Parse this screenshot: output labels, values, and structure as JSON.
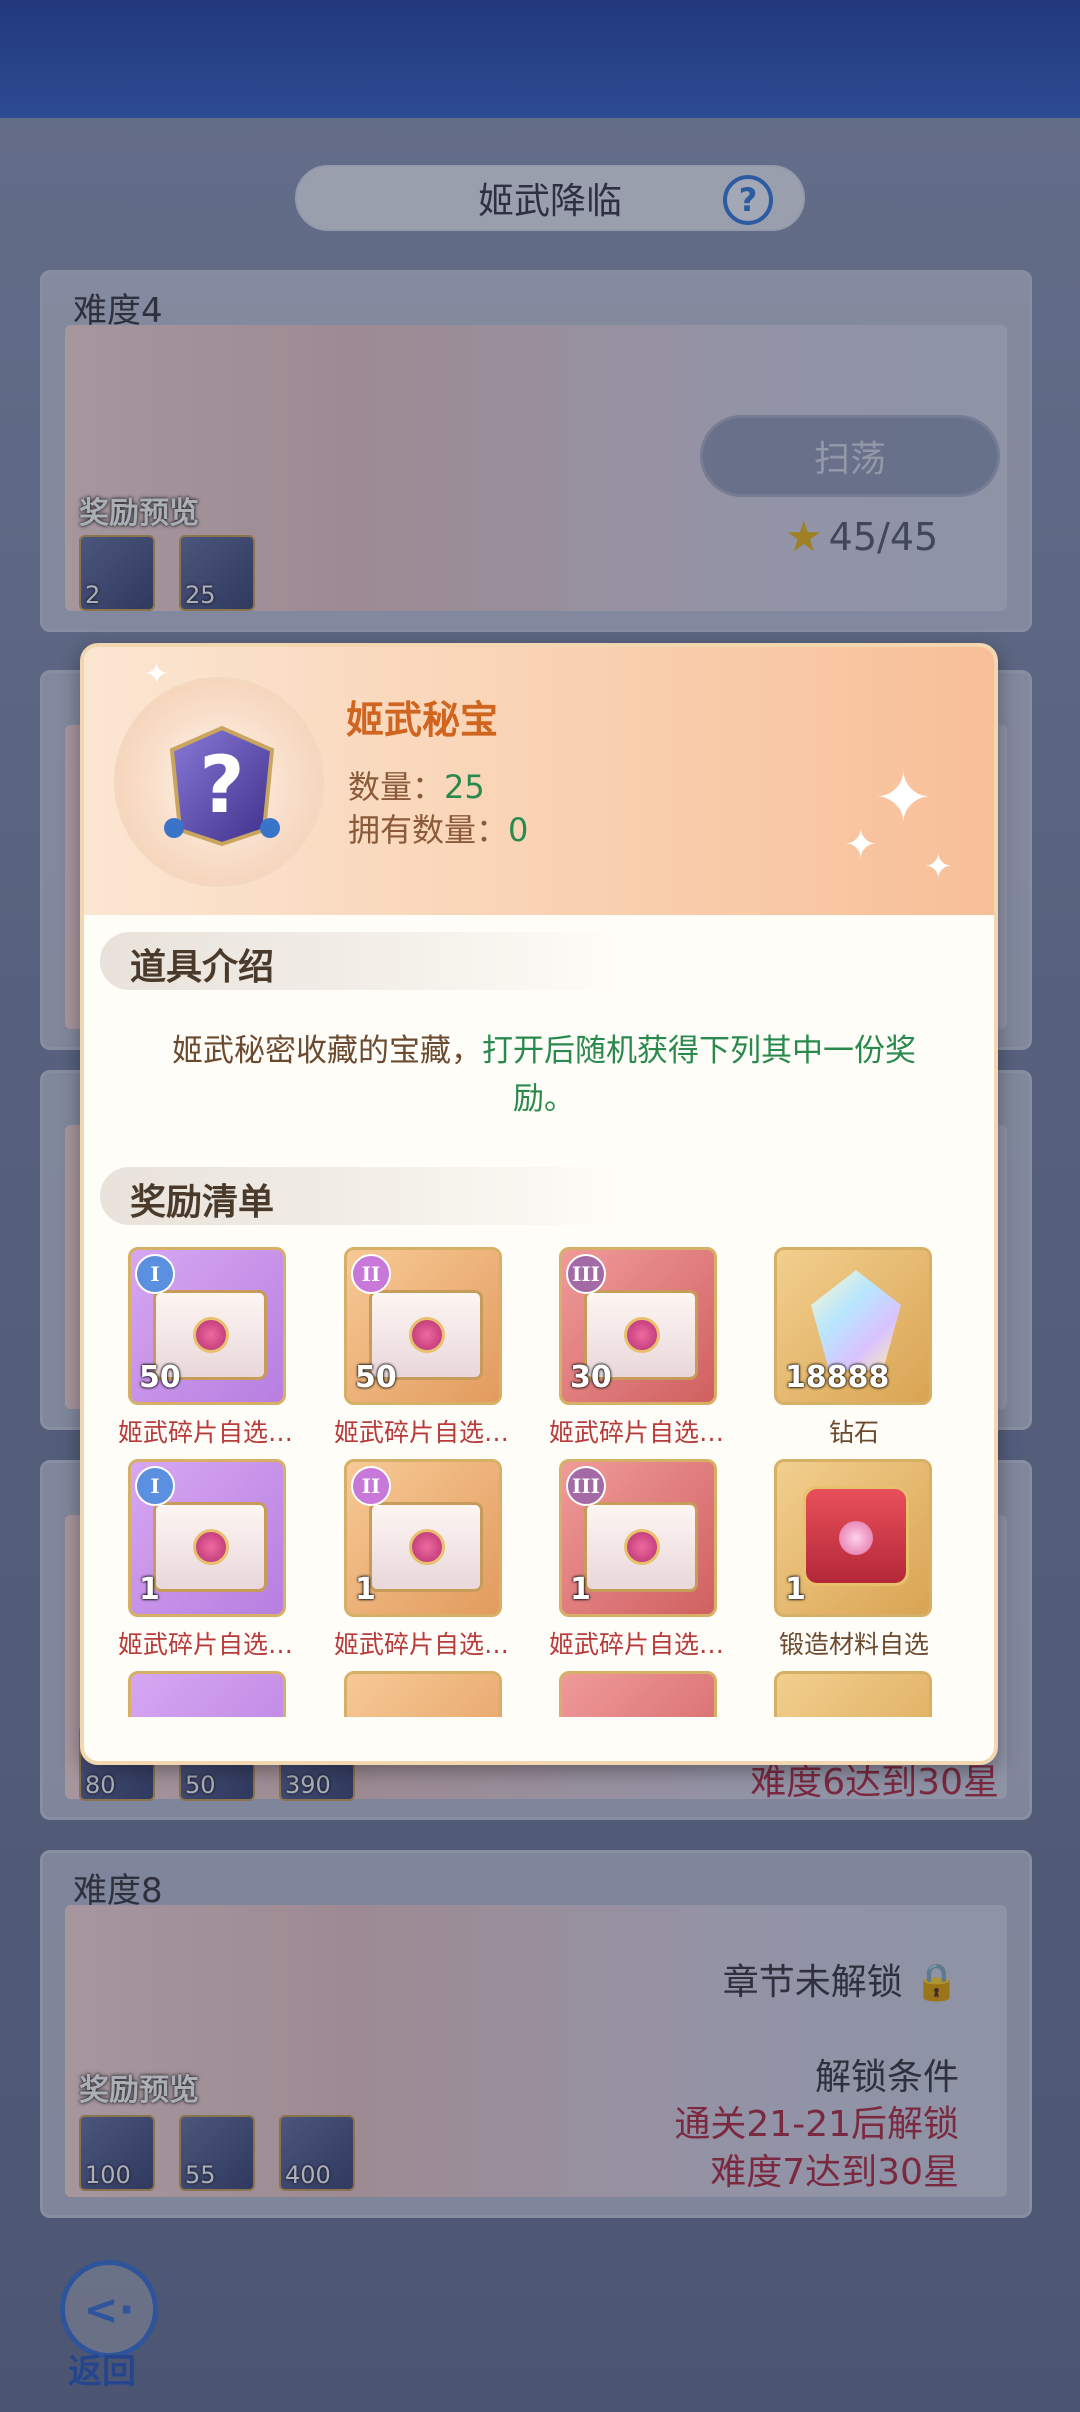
{
  "header": {
    "title": "姬武降临"
  },
  "stages": {
    "stage4": {
      "difficulty": "难度4",
      "preview_label": "奖励预览",
      "rewards": [
        "2",
        "25"
      ],
      "sweep_label": "扫荡",
      "stars": "45/45"
    },
    "stage7_partial": {
      "rewards": [
        "80",
        "50",
        "390"
      ],
      "unlock_line3": "难度6达到30星"
    },
    "stage8": {
      "difficulty": "难度8",
      "locked": "章节未解锁",
      "preview_label": "奖励预览",
      "rewards": [
        "100",
        "55",
        "400"
      ],
      "unlock_title": "解锁条件",
      "unlock_line1": "通关21-21后解锁",
      "unlock_line2": "难度7达到30星"
    }
  },
  "back": {
    "label": "返回"
  },
  "popup": {
    "item_name": "姬武秘宝",
    "qty_label": "数量：",
    "qty_value": "25",
    "own_label": "拥有数量：",
    "own_value": "0",
    "intro_title": "道具介绍",
    "desc_a": "姬武秘密收藏的宝藏，",
    "desc_b": "打开后随机获得下列其中一份奖励。",
    "list_title": "奖励清单",
    "rewards": [
      {
        "tier": "I",
        "count": "50",
        "name": "姬武碎片自选宝箱",
        "style": "purple"
      },
      {
        "tier": "II",
        "count": "50",
        "name": "姬武碎片自选宝箱",
        "style": "orange"
      },
      {
        "tier": "III",
        "count": "30",
        "name": "姬武碎片自选宝箱",
        "style": "red"
      },
      {
        "tier": "",
        "count": "18888",
        "name": "钻石",
        "style": "gold"
      },
      {
        "tier": "I",
        "count": "1",
        "name": "姬武碎片自选宝箱",
        "style": "purple"
      },
      {
        "tier": "II",
        "count": "1",
        "name": "姬武碎片自选宝箱",
        "style": "orange"
      },
      {
        "tier": "III",
        "count": "1",
        "name": "姬武碎片自选宝箱",
        "style": "red"
      },
      {
        "tier": "",
        "count": "1",
        "name": "锻造材料自选",
        "style": "gold"
      }
    ]
  },
  "colors": {
    "accent_green": "#2a8a4e",
    "title_orange": "#d0651f",
    "warn_red": "#b2324a"
  }
}
